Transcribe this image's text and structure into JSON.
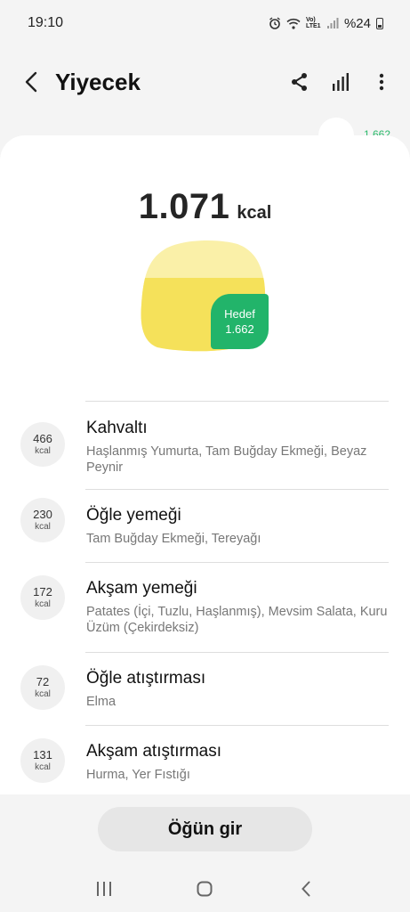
{
  "status_bar": {
    "time": "19:10",
    "battery_text": "%24",
    "network_label": "Vo) LTE1",
    "icons": [
      "alarm-icon",
      "wifi-icon",
      "volte-icon",
      "signal-icon",
      "battery-icon"
    ]
  },
  "app_bar": {
    "title": "Yiyecek",
    "icons": [
      "back-icon",
      "share-icon",
      "stats-icon",
      "more-icon"
    ]
  },
  "peek_value": "1.662",
  "summary": {
    "total_value": "1.071",
    "total_unit": "kcal",
    "goal_label": "Hedef",
    "goal_value": "1.662",
    "progress_fraction": 0.644
  },
  "meals": [
    {
      "kcal": "466",
      "unit": "kcal",
      "name": "Kahvaltı",
      "items": "Haşlanmış Yumurta, Tam Buğday Ekmeği, Beyaz Peynir"
    },
    {
      "kcal": "230",
      "unit": "kcal",
      "name": "Öğle yemeği",
      "items": "Tam Buğday Ekmeği, Tereyağı"
    },
    {
      "kcal": "172",
      "unit": "kcal",
      "name": "Akşam yemeği",
      "items": "Patates (İçi, Tuzlu, Haşlanmış), Mevsim Salata, Kuru Üzüm (Çekirdeksiz)"
    },
    {
      "kcal": "72",
      "unit": "kcal",
      "name": "Öğle atıştırması",
      "items": "Elma"
    },
    {
      "kcal": "131",
      "unit": "kcal",
      "name": "Akşam atıştırması",
      "items": "Hurma, Yer Fıstığı"
    }
  ],
  "log_button": "Öğün gir",
  "colors": {
    "accent_green": "#22b46a",
    "chart_yellow": "#f5e15a",
    "chart_yellow_light": "#faf0a8"
  },
  "nav_bar": {
    "icons": [
      "recents-icon",
      "home-icon",
      "back-nav-icon"
    ]
  }
}
